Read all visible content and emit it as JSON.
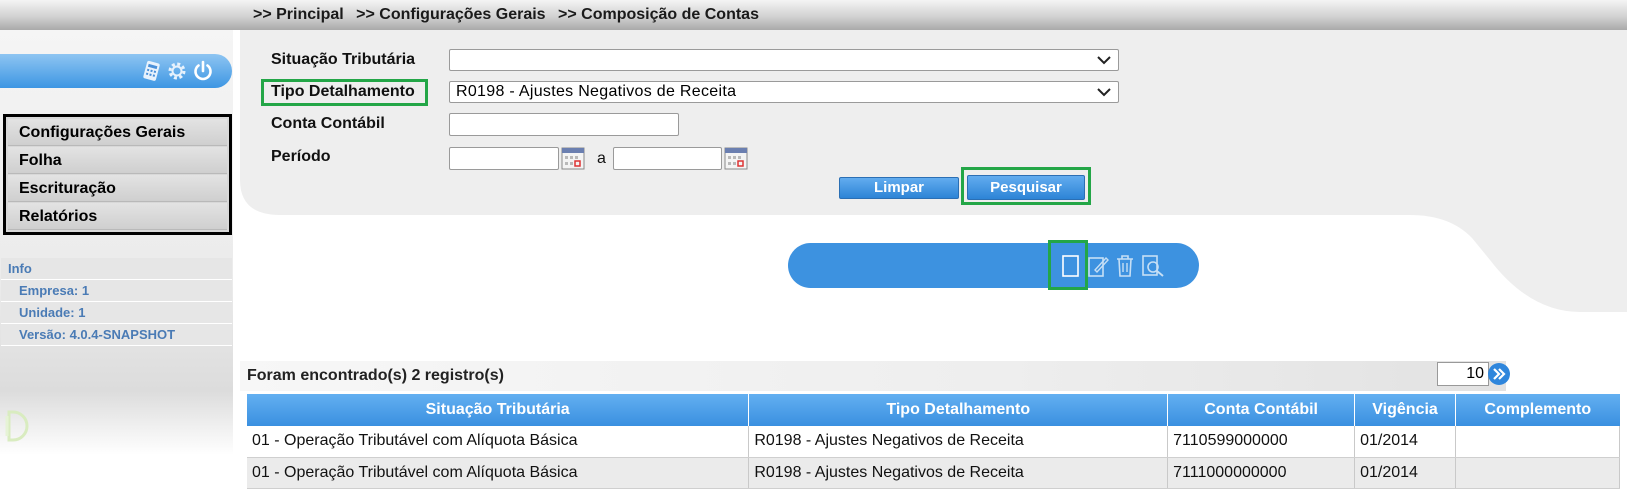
{
  "breadcrumb": [
    ">> Principal",
    ">> Configurações Gerais",
    ">> Composição de Contas"
  ],
  "sidebar": {
    "menu": [
      "Configurações Gerais",
      "Folha",
      "Escrituração",
      "Relatórios"
    ],
    "info_title": "Info",
    "info_items": [
      "Empresa: 1",
      "Unidade: 1",
      "Versão: 4.0.4-SNAPSHOT"
    ]
  },
  "filter": {
    "situacao_label": "Situação Tributária",
    "situacao_value": "",
    "tipo_label": "Tipo Detalhamento",
    "tipo_value": "R0198 - Ajustes Negativos de Receita",
    "conta_label": "Conta Contábil",
    "conta_value": "",
    "periodo_label": "Período",
    "periodo_sep": "a",
    "periodo_from": "",
    "periodo_to": "",
    "limpar_label": "Limpar",
    "pesquisar_label": "Pesquisar"
  },
  "results": {
    "summary": "Foram encontrado(s) 2 registro(s)",
    "page_size": "10",
    "columns": [
      "Situação Tributária",
      "Tipo Detalhamento",
      "Conta Contábil",
      "Vigência",
      "Complemento"
    ],
    "rows": [
      [
        "01 - Operação Tributável com Alíquota Básica",
        "R0198 - Ajustes Negativos de Receita",
        "7110599000000",
        "01/2014",
        ""
      ],
      [
        "01 - Operação Tributável com Alíquota Básica",
        "R0198 - Ajustes Negativos de Receita",
        "7111000000000",
        "01/2014",
        ""
      ]
    ]
  },
  "colors": {
    "accent_blue": "#3d92e0",
    "highlight_green": "#23a647"
  },
  "icons": [
    "calculator-icon",
    "gear-icon",
    "power-icon",
    "calendar-icon",
    "new-document-icon",
    "edit-icon",
    "delete-icon",
    "search-document-icon",
    "double-chevron-right-icon",
    "chevron-down-icon"
  ]
}
